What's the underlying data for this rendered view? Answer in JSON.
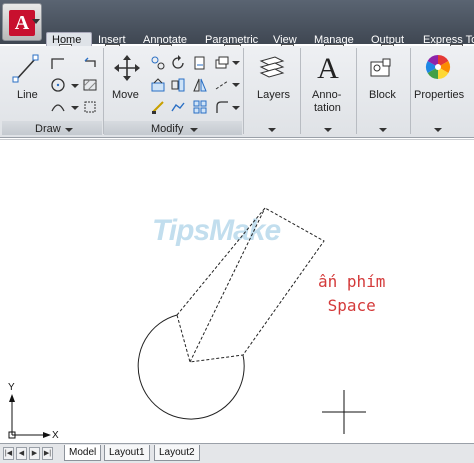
{
  "app": {
    "logo_letter": "A",
    "brand_color": "#c8102e"
  },
  "tabs": [
    {
      "label": "Home",
      "keytip": "H",
      "active": true
    },
    {
      "label": "Insert",
      "keytip": "IN"
    },
    {
      "label": "Annotate",
      "keytip": "A"
    },
    {
      "label": "Parametric",
      "keytip": "PA"
    },
    {
      "label": "View",
      "keytip": "V"
    },
    {
      "label": "Manage",
      "keytip": "MA"
    },
    {
      "label": "Output",
      "keytip": "O"
    },
    {
      "label": "Express Too",
      "keytip": "E"
    }
  ],
  "ribbon": {
    "draw": {
      "title": "Draw",
      "line_label": "Line"
    },
    "modify": {
      "title": "Modify",
      "move_label": "Move"
    },
    "layers": {
      "label": "Layers"
    },
    "annotation": {
      "label_line1": "Anno-",
      "label_line2": "tation"
    },
    "block": {
      "label": "Block"
    },
    "properties": {
      "label": "Properties"
    }
  },
  "drawing": {
    "watermark": "TipsMake",
    "annotation_line1": "ấn phím",
    "annotation_line2": "Space",
    "annotation_color": "#d43a3a",
    "ucs_x": "X",
    "ucs_y": "Y"
  },
  "layout_tabs": [
    {
      "label": "Model",
      "active": true
    },
    {
      "label": "Layout1"
    },
    {
      "label": "Layout2"
    }
  ],
  "nav_buttons": [
    "first",
    "previous",
    "next",
    "last"
  ]
}
